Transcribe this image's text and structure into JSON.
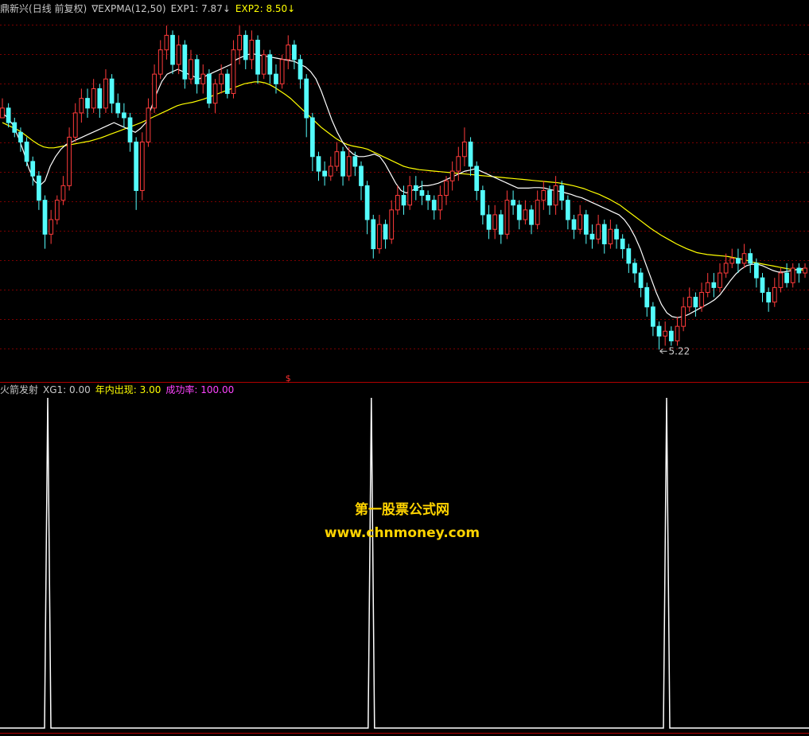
{
  "header": {
    "stock": "鼎新兴",
    "period": "(日线 前复权)",
    "indicator_marker": "∇",
    "indicator": "EXPMA(12,50)",
    "exp1_label": "EXP1:",
    "exp1_value": "7.87",
    "exp1_arrow": "↓",
    "exp2_label": "EXP2:",
    "exp2_value": "8.50",
    "exp2_arrow": "↓"
  },
  "sub_header": {
    "name": "火箭发射",
    "xg1_label": "XG1:",
    "xg1_value": "0.00",
    "count_label": "年内出现:",
    "count_value": "3.00",
    "rate_label": "成功率:",
    "rate_value": "100.00"
  },
  "watermark": {
    "title": "第一股票公式网",
    "url": "www.chnmoney.com"
  },
  "colors": {
    "up": "#ff3b3b",
    "down": "#54fcfc",
    "exp1": "#ffffff",
    "exp2": "#ffff00",
    "grid": "#7a0000",
    "axis": "#b00000",
    "header_text": "#c8c8c8",
    "exp2_text": "#ffff00",
    "count_text": "#ffff00",
    "rate_text": "#ff44ff",
    "watermark": "#ffd400"
  },
  "chart_data": [
    {
      "type": "candlestick",
      "title": "EXPMA(12,50)",
      "ylim": [
        4.8,
        12.1
      ],
      "grid": true,
      "low_annotation": "5.22",
      "signal_marker": "$",
      "series": [
        {
          "name": "EXP1",
          "values": [
            10.1,
            10.0,
            9.85,
            9.6,
            9.3,
            8.95,
            8.7,
            8.6,
            8.7,
            9.0,
            9.2,
            9.35,
            9.45,
            9.5,
            9.55,
            9.6,
            9.65,
            9.7,
            9.75,
            9.8,
            9.85,
            9.9,
            9.85,
            9.8,
            9.75,
            9.7,
            9.78,
            9.9,
            10.2,
            10.5,
            10.75,
            10.9,
            10.95,
            11.0,
            10.95,
            10.9,
            10.85,
            10.8,
            10.85,
            10.9,
            10.95,
            11.0,
            11.05,
            11.1,
            11.2,
            11.25,
            11.3,
            11.32,
            11.3,
            11.28,
            11.26,
            11.24,
            11.22,
            11.2,
            11.18,
            11.16,
            11.1,
            11.05,
            10.95,
            10.8,
            10.55,
            10.25,
            9.95,
            9.7,
            9.5,
            9.35,
            9.25,
            9.2,
            9.2,
            9.22,
            9.25,
            9.2,
            9.05,
            8.85,
            8.65,
            8.5,
            8.45,
            8.5,
            8.55,
            8.6,
            8.6,
            8.62,
            8.65,
            8.7,
            8.75,
            8.8,
            8.85,
            8.9,
            8.92,
            8.95,
            8.9,
            8.85,
            8.8,
            8.75,
            8.7,
            8.65,
            8.6,
            8.55,
            8.55,
            8.55,
            8.56,
            8.56,
            8.55,
            8.52,
            8.5,
            8.48,
            8.45,
            8.42,
            8.38,
            8.35,
            8.3,
            8.25,
            8.2,
            8.15,
            8.1,
            8.05,
            8.0,
            7.9,
            7.75,
            7.55,
            7.3,
            7.0,
            6.7,
            6.4,
            6.15,
            5.98,
            5.9,
            5.88,
            5.9,
            5.94,
            6.0,
            6.06,
            6.12,
            6.18,
            6.25,
            6.35,
            6.5,
            6.65,
            6.78,
            6.88,
            6.95,
            6.98,
            6.98,
            6.95,
            6.9,
            6.85,
            6.82,
            6.82,
            6.84,
            6.86,
            6.88,
            6.9
          ]
        },
        {
          "name": "EXP2",
          "values": [
            9.9,
            9.85,
            9.8,
            9.75,
            9.68,
            9.6,
            9.52,
            9.45,
            9.4,
            9.38,
            9.38,
            9.4,
            9.42,
            9.44,
            9.46,
            9.48,
            9.5,
            9.52,
            9.55,
            9.58,
            9.62,
            9.66,
            9.7,
            9.74,
            9.78,
            9.82,
            9.86,
            9.9,
            9.95,
            10.0,
            10.05,
            10.1,
            10.15,
            10.2,
            10.25,
            10.28,
            10.3,
            10.32,
            10.35,
            10.38,
            10.42,
            10.46,
            10.5,
            10.54,
            10.58,
            10.62,
            10.66,
            10.7,
            10.72,
            10.74,
            10.74,
            10.72,
            10.68,
            10.62,
            10.55,
            10.48,
            10.4,
            10.3,
            10.2,
            10.1,
            10.0,
            9.9,
            9.8,
            9.72,
            9.64,
            9.56,
            9.5,
            9.45,
            9.42,
            9.4,
            9.38,
            9.35,
            9.3,
            9.25,
            9.2,
            9.15,
            9.1,
            9.05,
            9.0,
            8.97,
            8.95,
            8.93,
            8.92,
            8.91,
            8.9,
            8.89,
            8.88,
            8.87,
            8.86,
            8.85,
            8.84,
            8.83,
            8.82,
            8.81,
            8.8,
            8.79,
            8.78,
            8.77,
            8.76,
            8.75,
            8.74,
            8.73,
            8.72,
            8.71,
            8.7,
            8.69,
            8.68,
            8.67,
            8.66,
            8.64,
            8.62,
            8.6,
            8.57,
            8.54,
            8.5,
            8.46,
            8.42,
            8.37,
            8.32,
            8.26,
            8.2,
            8.12,
            8.04,
            7.96,
            7.88,
            7.8,
            7.72,
            7.65,
            7.58,
            7.52,
            7.46,
            7.4,
            7.35,
            7.3,
            7.26,
            7.22,
            7.2,
            7.18,
            7.17,
            7.16,
            7.15,
            7.14,
            7.12,
            7.1,
            7.08,
            7.05,
            7.02,
            7.0,
            6.98,
            6.96,
            6.94,
            6.92,
            6.9,
            6.88,
            6.87,
            6.86,
            6.86
          ]
        }
      ],
      "candles": [
        [
          10.0,
          10.2,
          10.1,
          10.4
        ],
        [
          10.2,
          9.9,
          9.8,
          10.3
        ],
        [
          9.9,
          9.7,
          9.6,
          10.0
        ],
        [
          9.7,
          9.5,
          9.3,
          9.8
        ],
        [
          9.5,
          9.1,
          9.0,
          9.6
        ],
        [
          9.1,
          8.8,
          8.6,
          9.2
        ],
        [
          8.8,
          8.3,
          8.1,
          8.9
        ],
        [
          8.3,
          7.6,
          7.3,
          8.4
        ],
        [
          7.6,
          7.9,
          7.4,
          8.1
        ],
        [
          7.9,
          8.3,
          7.8,
          8.4
        ],
        [
          8.3,
          8.6,
          8.2,
          8.8
        ],
        [
          8.6,
          9.6,
          8.5,
          9.8
        ],
        [
          9.6,
          10.1,
          9.5,
          10.3
        ],
        [
          10.1,
          10.4,
          9.9,
          10.6
        ],
        [
          10.4,
          10.2,
          10.0,
          10.6
        ],
        [
          10.2,
          10.6,
          10.1,
          10.8
        ],
        [
          10.6,
          10.2,
          10.0,
          10.7
        ],
        [
          10.2,
          10.8,
          10.1,
          11.0
        ],
        [
          10.8,
          10.3,
          10.1,
          10.9
        ],
        [
          10.3,
          10.1,
          10.0,
          10.5
        ],
        [
          10.1,
          10.0,
          9.8,
          10.3
        ],
        [
          10.0,
          9.5,
          9.3,
          10.1
        ],
        [
          9.5,
          8.5,
          8.1,
          9.6
        ],
        [
          8.5,
          9.5,
          8.3,
          9.7
        ],
        [
          9.5,
          10.2,
          9.4,
          10.4
        ],
        [
          10.2,
          10.9,
          10.1,
          11.1
        ],
        [
          10.9,
          11.4,
          10.8,
          11.6
        ],
        [
          11.4,
          11.7,
          11.2,
          11.9
        ],
        [
          11.7,
          11.1,
          10.9,
          11.8
        ],
        [
          11.1,
          11.5,
          10.9,
          11.7
        ],
        [
          11.5,
          10.8,
          10.6,
          11.6
        ],
        [
          10.8,
          11.2,
          10.7,
          11.4
        ],
        [
          11.2,
          10.7,
          10.5,
          11.3
        ],
        [
          10.7,
          10.9,
          10.5,
          11.1
        ],
        [
          10.9,
          10.3,
          10.2,
          11.0
        ],
        [
          10.3,
          10.7,
          10.1,
          10.8
        ],
        [
          10.7,
          10.9,
          10.5,
          11.1
        ],
        [
          10.9,
          10.5,
          10.4,
          11.0
        ],
        [
          10.5,
          11.4,
          10.4,
          11.6
        ],
        [
          11.4,
          11.7,
          11.1,
          11.9
        ],
        [
          11.7,
          11.2,
          11.0,
          11.8
        ],
        [
          11.2,
          11.6,
          11.0,
          11.8
        ],
        [
          11.6,
          10.9,
          10.7,
          11.7
        ],
        [
          10.9,
          11.3,
          10.8,
          11.4
        ],
        [
          11.3,
          10.9,
          10.7,
          11.4
        ],
        [
          10.9,
          10.7,
          10.5,
          11.1
        ],
        [
          10.7,
          11.2,
          10.6,
          11.3
        ],
        [
          11.2,
          11.5,
          11.0,
          11.7
        ],
        [
          11.5,
          11.2,
          11.0,
          11.6
        ],
        [
          11.2,
          10.8,
          10.6,
          11.3
        ],
        [
          10.8,
          10.0,
          9.6,
          10.9
        ],
        [
          10.0,
          9.2,
          8.9,
          10.1
        ],
        [
          9.2,
          8.9,
          8.7,
          9.3
        ],
        [
          8.9,
          8.8,
          8.6,
          9.1
        ],
        [
          8.8,
          9.0,
          8.7,
          9.2
        ],
        [
          9.0,
          9.3,
          8.9,
          9.5
        ],
        [
          9.3,
          8.8,
          8.6,
          9.4
        ],
        [
          8.8,
          9.2,
          8.7,
          9.4
        ],
        [
          9.2,
          9.0,
          8.8,
          9.3
        ],
        [
          9.0,
          8.6,
          8.3,
          9.1
        ],
        [
          8.6,
          7.9,
          7.6,
          8.7
        ],
        [
          7.9,
          7.3,
          7.1,
          8.0
        ],
        [
          7.3,
          7.8,
          7.2,
          8.0
        ],
        [
          7.8,
          7.5,
          7.3,
          7.9
        ],
        [
          7.5,
          8.1,
          7.4,
          8.3
        ],
        [
          8.1,
          8.4,
          8.0,
          8.6
        ],
        [
          8.4,
          8.2,
          8.0,
          8.6
        ],
        [
          8.2,
          8.6,
          8.1,
          8.8
        ],
        [
          8.6,
          8.5,
          8.3,
          8.8
        ],
        [
          8.5,
          8.4,
          8.2,
          8.7
        ],
        [
          8.4,
          8.3,
          8.1,
          8.5
        ],
        [
          8.3,
          8.1,
          7.9,
          8.4
        ],
        [
          8.1,
          8.4,
          7.9,
          8.6
        ],
        [
          8.4,
          8.7,
          8.2,
          8.8
        ],
        [
          8.7,
          8.9,
          8.5,
          9.1
        ],
        [
          8.9,
          9.2,
          8.7,
          9.4
        ],
        [
          9.2,
          9.5,
          9.0,
          9.8
        ],
        [
          9.5,
          9.0,
          8.8,
          9.6
        ],
        [
          9.0,
          8.5,
          8.3,
          9.1
        ],
        [
          8.5,
          8.0,
          7.8,
          8.6
        ],
        [
          8.0,
          7.7,
          7.5,
          8.2
        ],
        [
          7.7,
          8.0,
          7.5,
          8.2
        ],
        [
          8.0,
          7.6,
          7.4,
          8.1
        ],
        [
          7.6,
          8.3,
          7.5,
          8.5
        ],
        [
          8.3,
          8.2,
          8.0,
          8.5
        ],
        [
          8.2,
          7.9,
          7.7,
          8.3
        ],
        [
          7.9,
          8.1,
          7.8,
          8.3
        ],
        [
          8.1,
          7.8,
          7.6,
          8.2
        ],
        [
          7.8,
          8.3,
          7.7,
          8.5
        ],
        [
          8.3,
          8.5,
          8.1,
          8.7
        ],
        [
          8.5,
          8.2,
          8.0,
          8.6
        ],
        [
          8.2,
          8.6,
          8.0,
          8.8
        ],
        [
          8.6,
          8.3,
          8.1,
          8.7
        ],
        [
          8.3,
          7.9,
          7.7,
          8.4
        ],
        [
          7.9,
          7.7,
          7.5,
          8.0
        ],
        [
          7.7,
          8.0,
          7.6,
          8.2
        ],
        [
          8.0,
          7.6,
          7.4,
          8.1
        ],
        [
          7.6,
          7.5,
          7.3,
          7.8
        ],
        [
          7.5,
          7.8,
          7.4,
          8.0
        ],
        [
          7.8,
          7.4,
          7.2,
          7.9
        ],
        [
          7.4,
          7.7,
          7.3,
          7.9
        ],
        [
          7.7,
          7.5,
          7.3,
          7.8
        ],
        [
          7.5,
          7.3,
          7.1,
          7.6
        ],
        [
          7.3,
          7.0,
          6.8,
          7.4
        ],
        [
          7.0,
          6.8,
          6.6,
          7.1
        ],
        [
          6.8,
          6.5,
          6.3,
          6.9
        ],
        [
          6.5,
          6.1,
          5.9,
          6.6
        ],
        [
          6.1,
          5.7,
          5.5,
          6.2
        ],
        [
          5.7,
          5.5,
          5.22,
          5.8
        ],
        [
          5.5,
          5.6,
          5.3,
          5.8
        ],
        [
          5.6,
          5.4,
          5.3,
          5.7
        ],
        [
          5.4,
          5.7,
          5.3,
          5.9
        ],
        [
          5.7,
          6.1,
          5.6,
          6.3
        ],
        [
          6.1,
          6.3,
          6.0,
          6.5
        ],
        [
          6.3,
          6.1,
          5.9,
          6.4
        ],
        [
          6.1,
          6.4,
          6.0,
          6.6
        ],
        [
          6.4,
          6.6,
          6.3,
          6.8
        ],
        [
          6.6,
          6.5,
          6.3,
          6.8
        ],
        [
          6.5,
          6.8,
          6.4,
          7.0
        ],
        [
          6.8,
          7.0,
          6.7,
          7.2
        ],
        [
          7.0,
          7.1,
          6.9,
          7.3
        ],
        [
          7.1,
          7.0,
          6.8,
          7.3
        ],
        [
          7.0,
          7.2,
          6.9,
          7.4
        ],
        [
          7.2,
          7.0,
          6.8,
          7.3
        ],
        [
          7.0,
          6.7,
          6.5,
          7.1
        ],
        [
          6.7,
          6.4,
          6.2,
          6.8
        ],
        [
          6.4,
          6.2,
          6.0,
          6.5
        ],
        [
          6.2,
          6.5,
          6.1,
          6.7
        ],
        [
          6.5,
          6.8,
          6.4,
          6.9
        ],
        [
          6.8,
          6.6,
          6.5,
          7.0
        ],
        [
          6.6,
          6.9,
          6.5,
          7.0
        ],
        [
          6.9,
          6.8,
          6.6,
          7.0
        ],
        [
          6.8,
          6.9,
          6.7,
          7.0
        ]
      ]
    },
    {
      "type": "line",
      "title": "火箭发射",
      "ylim": [
        0,
        1
      ],
      "series": [
        {
          "name": "XG1",
          "signal_positions": [
            0.059,
            0.459,
            0.824
          ],
          "signal_value": 1
        }
      ]
    }
  ]
}
